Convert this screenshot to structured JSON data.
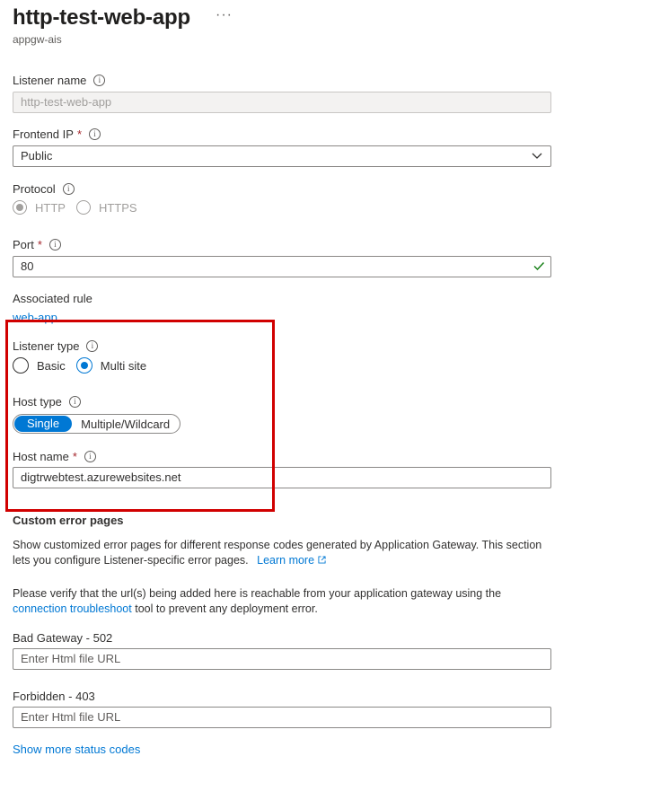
{
  "header": {
    "title": "http-test-web-app",
    "more_label": "···",
    "subtitle": "appgw-ais"
  },
  "listener_name": {
    "label": "Listener name",
    "value": "http-test-web-app"
  },
  "frontend_ip": {
    "label": "Frontend IP",
    "required_mark": "*",
    "value": "Public"
  },
  "protocol": {
    "label": "Protocol",
    "options": [
      "HTTP",
      "HTTPS"
    ],
    "selected": "HTTP"
  },
  "port": {
    "label": "Port",
    "required_mark": "*",
    "value": "80"
  },
  "associated_rule": {
    "label": "Associated rule",
    "link": "web-app"
  },
  "listener_type": {
    "label": "Listener type",
    "options": [
      "Basic",
      "Multi site"
    ],
    "selected": "Multi site"
  },
  "host_type": {
    "label": "Host type",
    "options": [
      "Single",
      "Multiple/Wildcard"
    ],
    "selected": "Single"
  },
  "host_name": {
    "label": "Host name",
    "required_mark": "*",
    "value": "digtrwebtest.azurewebsites.net"
  },
  "custom_error": {
    "heading": "Custom error pages",
    "desc_1": "Show customized error pages for different response codes generated by Application Gateway. This section lets you configure Listener-specific error pages.",
    "learn_more": "Learn more",
    "desc_2_pre": "Please verify that the url(s) being added here is reachable from your application gateway using the",
    "desc_2_link": "connection troubleshoot",
    "desc_2_post": "tool to prevent any deployment error.",
    "bad_gateway_label": "Bad Gateway - 502",
    "bad_gateway_placeholder": "Enter Html file URL",
    "forbidden_label": "Forbidden - 403",
    "forbidden_placeholder": "Enter Html file URL",
    "show_more": "Show more status codes"
  },
  "colors": {
    "accent": "#0078d4",
    "highlight": "#d10000",
    "required": "#a4262c",
    "valid": "#107c10"
  }
}
